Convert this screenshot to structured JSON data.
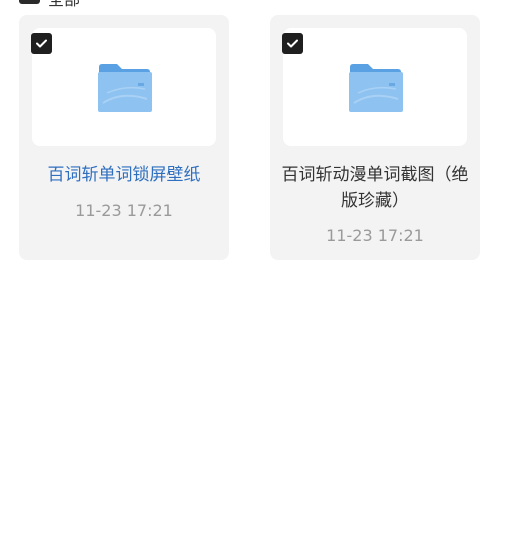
{
  "header": {
    "select_label": "全部"
  },
  "files": [
    {
      "name": "百词斩单词锁屏壁纸",
      "time": "11-23 17:21"
    },
    {
      "name": "百词斩动漫单词截图（绝版珍藏）",
      "time": "11-23 17:21"
    }
  ],
  "colors": {
    "accent": "#2f6fc0",
    "folder": "#7cb5ea",
    "card_bg": "#f3f3f3",
    "checkbox": "#1f1f1f"
  }
}
